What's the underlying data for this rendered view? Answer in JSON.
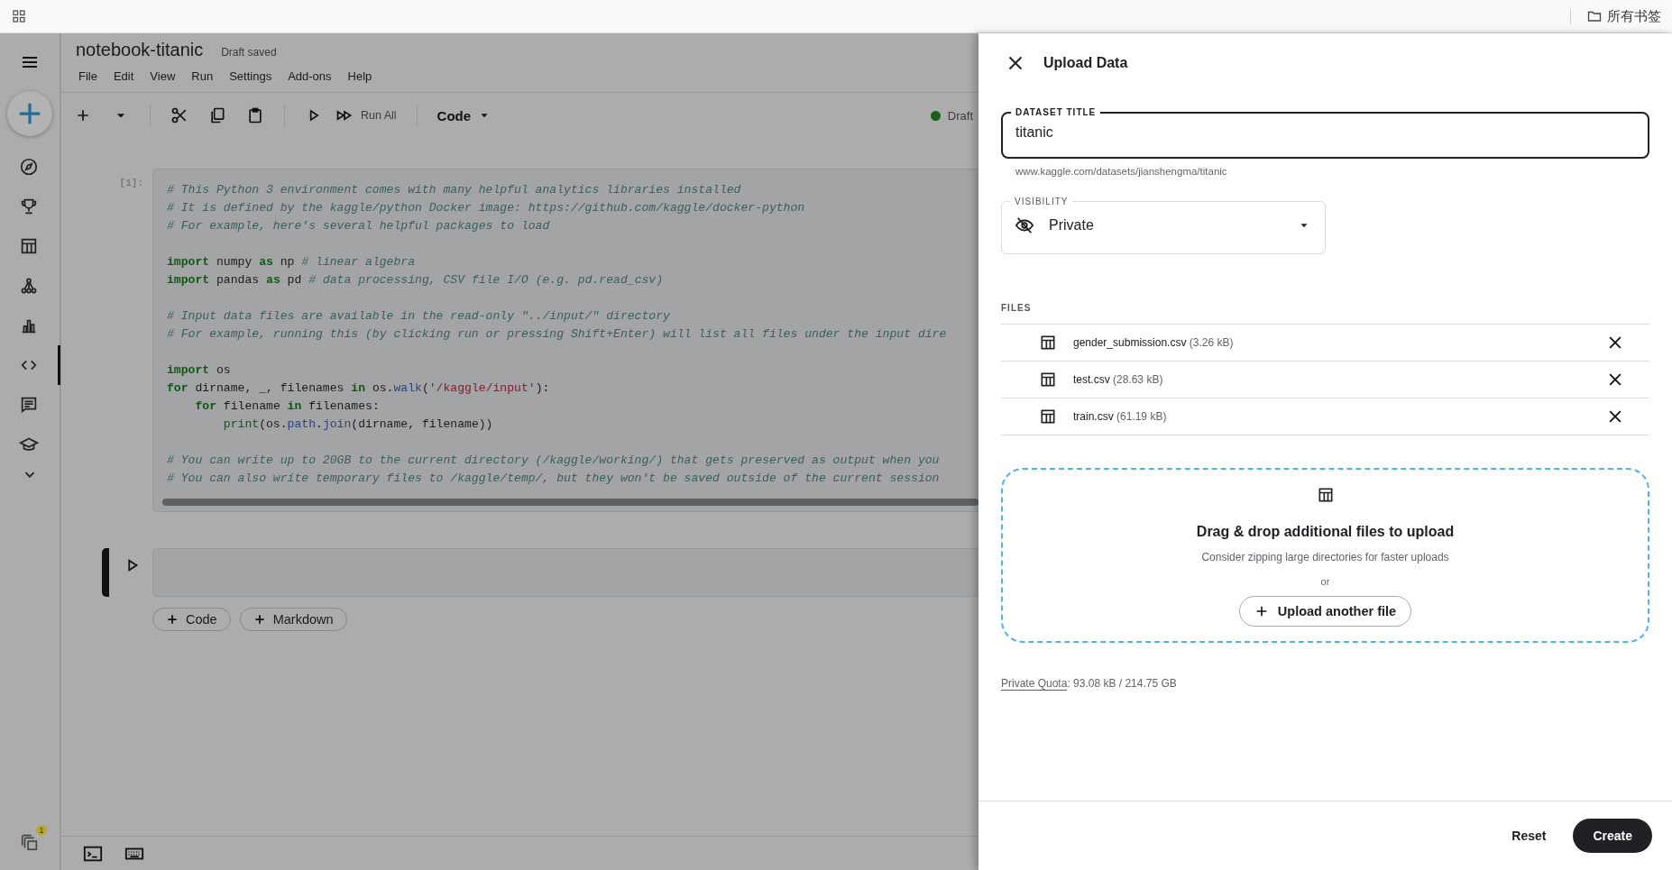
{
  "browser_bar": {
    "bookmarks_label": "所有书签"
  },
  "sidebar": {
    "items": [
      {
        "kind": "compass",
        "selected": false
      },
      {
        "kind": "trophy",
        "selected": false
      },
      {
        "kind": "table",
        "selected": false
      },
      {
        "kind": "models",
        "selected": false
      },
      {
        "kind": "chart",
        "selected": false
      },
      {
        "kind": "code",
        "selected": true
      },
      {
        "kind": "comments",
        "selected": false
      },
      {
        "kind": "learn",
        "selected": false
      }
    ],
    "windows_badge": "1"
  },
  "notebook": {
    "title": "notebook-titanic",
    "save_status": "Draft saved",
    "menu": [
      "File",
      "Edit",
      "View",
      "Run",
      "Settings",
      "Add-ons",
      "Help"
    ],
    "toolbar": {
      "run_all_label": "Run All",
      "cell_type": "Code",
      "status": {
        "label": "Draft",
        "color": "#1b5e20"
      }
    },
    "cells": [
      {
        "prompt": "[1]:",
        "active": false,
        "blocks": [
          [
            [
              {
                "kind": "comment",
                "text": "# This Python 3 environment comes with many helpful analytics libraries installed"
              }
            ],
            [
              {
                "kind": "comment",
                "text": "# It is defined by the kaggle/python Docker image: https://github.com/kaggle/docker-python"
              }
            ],
            [
              {
                "kind": "comment",
                "text": "# For example, here's several helpful packages to load"
              }
            ]
          ],
          [
            [
              {
                "kind": "keyword",
                "text": "import"
              },
              {
                "kind": "name",
                "text": " numpy "
              },
              {
                "kind": "keyword",
                "text": "as"
              },
              {
                "kind": "name",
                "text": " np "
              },
              {
                "kind": "comment",
                "text": "# linear algebra"
              }
            ],
            [
              {
                "kind": "keyword",
                "text": "import"
              },
              {
                "kind": "name",
                "text": " pandas "
              },
              {
                "kind": "keyword",
                "text": "as"
              },
              {
                "kind": "name",
                "text": " pd "
              },
              {
                "kind": "comment",
                "text": "# data processing, CSV file I/O (e.g. pd.read_csv)"
              }
            ]
          ],
          [
            [
              {
                "kind": "comment",
                "text": "# Input data files are available in the read-only \"../input/\" directory"
              }
            ],
            [
              {
                "kind": "comment",
                "text": "# For example, running this (by clicking run or pressing Shift+Enter) will list all files under the input dire"
              }
            ]
          ],
          [
            [
              {
                "kind": "keyword",
                "text": "import"
              },
              {
                "kind": "name",
                "text": " os"
              }
            ],
            [
              {
                "kind": "keyword",
                "text": "for"
              },
              {
                "kind": "name",
                "text": " dirname, _, filenames "
              },
              {
                "kind": "keyword",
                "text": "in"
              },
              {
                "kind": "name",
                "text": " os."
              },
              {
                "kind": "func",
                "text": "walk"
              },
              {
                "kind": "name",
                "text": "("
              },
              {
                "kind": "string",
                "text": "'/kaggle/input'"
              },
              {
                "kind": "name",
                "text": "):"
              }
            ],
            [
              {
                "kind": "keyword",
                "text": "    for"
              },
              {
                "kind": "name",
                "text": " filename "
              },
              {
                "kind": "keyword",
                "text": "in"
              },
              {
                "kind": "name",
                "text": " filenames:"
              }
            ],
            [
              {
                "kind": "builtin",
                "text": "        print"
              },
              {
                "kind": "name",
                "text": "(os."
              },
              {
                "kind": "func",
                "text": "path"
              },
              {
                "kind": "name",
                "text": "."
              },
              {
                "kind": "func",
                "text": "join"
              },
              {
                "kind": "name",
                "text": "(dirname, filename))"
              }
            ]
          ],
          [
            [
              {
                "kind": "comment",
                "text": "# You can write up to 20GB to the current directory (/kaggle/working/) that gets preserved as output when you"
              }
            ],
            [
              {
                "kind": "comment",
                "text": "# You can also write temporary files to /kaggle/temp/, but they won't be saved outside of the current session"
              }
            ]
          ]
        ]
      },
      {
        "active": true
      }
    ],
    "add_buttons": [
      "Code",
      "Markdown"
    ]
  },
  "drawer": {
    "title": "Upload Data",
    "dataset_title": {
      "label": "DATASET TITLE",
      "value": "titanic",
      "helper": "www.kaggle.com/datasets/jianshengma/titanic"
    },
    "visibility": {
      "label": "VISIBILITY",
      "value": "Private"
    },
    "files_label": "FILES",
    "files": [
      {
        "name": "gender_submission.csv",
        "size": "(3.26 kB)"
      },
      {
        "name": "test.csv",
        "size": "(28.63 kB)"
      },
      {
        "name": "train.csv",
        "size": "(61.19 kB)"
      }
    ],
    "dropzone": {
      "title": "Drag & drop additional files to upload",
      "hint": "Consider zipping large directories for faster uploads",
      "or": "or",
      "button": "Upload another file"
    },
    "quota": {
      "link": "Private Quota",
      "text": ": 93.08 kB / 214.75 GB"
    },
    "footer": {
      "reset": "Reset",
      "create": "Create"
    }
  }
}
